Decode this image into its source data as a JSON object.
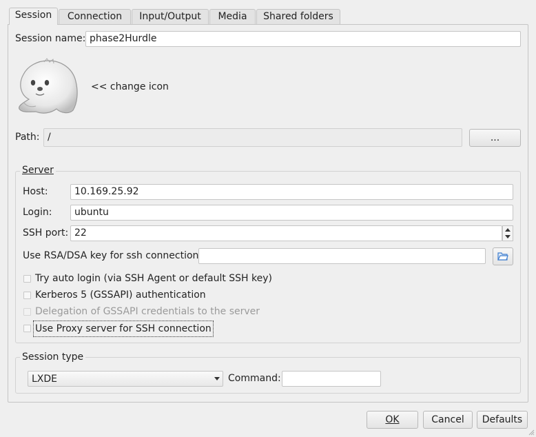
{
  "tabs": [
    {
      "label": "Session"
    },
    {
      "label": "Connection"
    },
    {
      "label": "Input/Output"
    },
    {
      "label": "Media"
    },
    {
      "label": "Shared folders"
    }
  ],
  "session": {
    "name_label": "Session name:",
    "name_value": "phase2Hurdle",
    "change_icon_label": "<< change icon",
    "path_label": "Path:",
    "path_value": "/",
    "path_button": "..."
  },
  "server": {
    "title": "Server",
    "host_label": "Host:",
    "host_value": "10.169.25.92",
    "login_label": "Login:",
    "login_value": "ubuntu",
    "port_label": "SSH port:",
    "port_value": "22",
    "key_label": "Use RSA/DSA key for ssh connection:",
    "key_value": "",
    "options": [
      {
        "label": "Try auto login (via SSH Agent or default SSH key)",
        "checked": false,
        "enabled": true
      },
      {
        "label": "Kerberos 5 (GSSAPI) authentication",
        "checked": false,
        "enabled": true
      },
      {
        "label": "Delegation of GSSAPI credentials to the server",
        "checked": false,
        "enabled": false
      },
      {
        "label": "Use Proxy server for SSH connection",
        "checked": false,
        "enabled": true
      }
    ]
  },
  "session_type": {
    "title": "Session type",
    "selected": "LXDE",
    "command_label": "Command:",
    "command_value": ""
  },
  "buttons": {
    "ok": "OK",
    "cancel": "Cancel",
    "defaults": "Defaults"
  },
  "colors": {
    "background": "#efefef",
    "disabled_text": "#9a9a9a",
    "folder_icon": "#3f7ecf"
  }
}
